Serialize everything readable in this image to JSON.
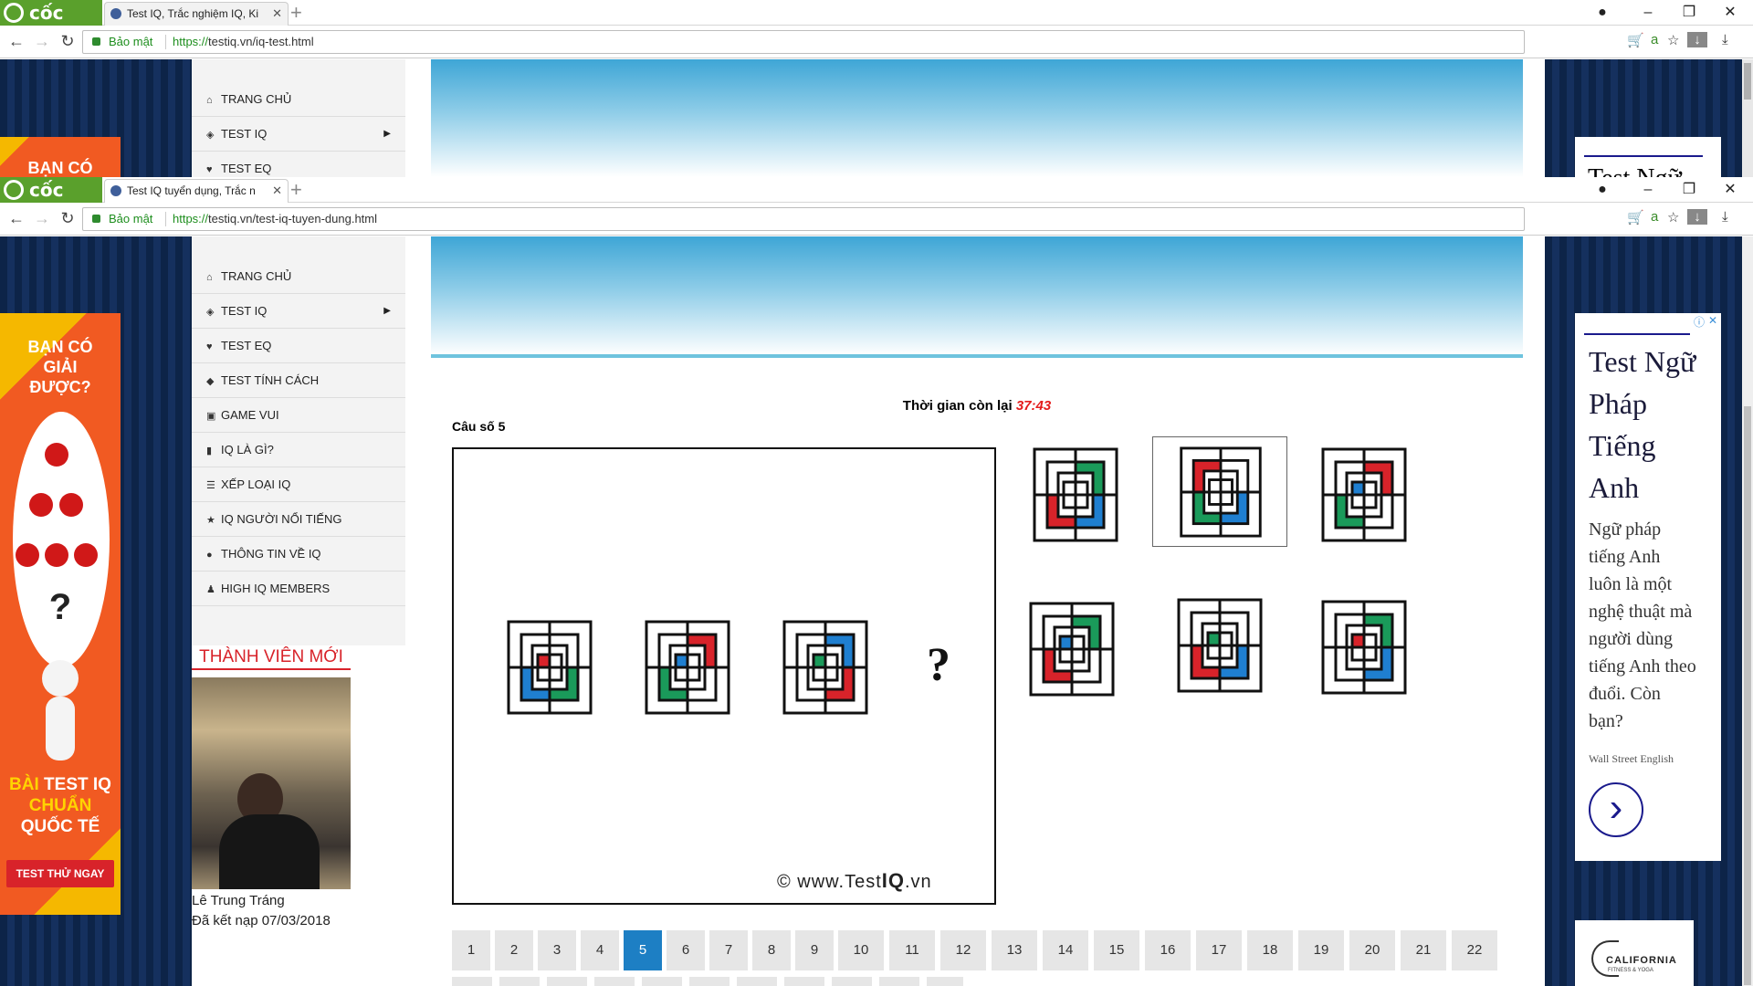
{
  "browser_back": {
    "app_name": "cốc cốc",
    "tab_title": "Test IQ, Trắc nghiệm IQ, Ki",
    "secure_label": "Bảo mật",
    "url_scheme": "https://",
    "url_rest": "testiq.vn/iq-test.html",
    "menu": [
      "TRANG CHỦ",
      "TEST IQ",
      "TEST EQ"
    ],
    "ad_partial": "Test Ngữ",
    "orange_partial": "BẠN CÓ"
  },
  "browser": {
    "app_name": "cốc cốc",
    "tab_title": "Test IQ tuyển dụng, Trắc n",
    "secure_label": "Bảo mật",
    "url_scheme": "https://",
    "url_rest": "testiq.vn/test-iq-tuyen-dung.html"
  },
  "sidebar": {
    "items": [
      {
        "label": "TRANG CHỦ",
        "icon": "home-icon"
      },
      {
        "label": "TEST IQ",
        "icon": "shield-icon",
        "has_submenu": true
      },
      {
        "label": "TEST EQ",
        "icon": "heart-icon"
      },
      {
        "label": "TEST TÍNH CÁCH",
        "icon": "chat-icon"
      },
      {
        "label": "GAME VUI",
        "icon": "gamepad-icon"
      },
      {
        "label": "IQ LÀ GÌ?",
        "icon": "book-icon"
      },
      {
        "label": "XẾP LOẠI IQ",
        "icon": "list-icon"
      },
      {
        "label": "IQ NGƯỜI NỔI TIẾNG",
        "icon": "star-icon"
      },
      {
        "label": "THÔNG TIN VỀ IQ",
        "icon": "info-icon"
      },
      {
        "label": "HIGH IQ MEMBERS",
        "icon": "users-icon"
      }
    ],
    "new_member_heading": "THÀNH VIÊN MỚI",
    "member_name": "Lê Trung Tráng",
    "member_joined": "Đã kết nạp 07/03/2018"
  },
  "left_ad": {
    "headline": [
      "BẠN CÓ",
      "GIẢI",
      "ĐƯỢC?"
    ],
    "tagline_lines": [
      "BÀI TEST IQ",
      "CHUẨN",
      "QUỐC TẾ"
    ],
    "tagline_highlight_words": [
      "BÀI",
      "CHUẨN"
    ],
    "cta": "TEST THỬ NGAY",
    "puzzle_mark": "?"
  },
  "quiz": {
    "timer_label": "Thời gian còn lại",
    "timer_value": "37:43",
    "question_label": "Câu số 5",
    "question_mark": "?",
    "watermark_prefix": "© www.Test",
    "watermark_bold": "IQ",
    "watermark_suffix": ".vn",
    "colors": {
      "red": "#d8232a",
      "green": "#1a9a5a",
      "blue": "#1f7fd0"
    },
    "sequence": [
      {
        "tr": "none",
        "br": "green",
        "bl": "blue",
        "tl": "none",
        "inner": "red"
      },
      {
        "tr": "red",
        "br": "none",
        "bl": "green",
        "tl": "none",
        "inner": "blue"
      },
      {
        "tr": "blue",
        "br": "red",
        "bl": "none",
        "tl": "none",
        "inner": "green"
      }
    ],
    "options": [
      {
        "tr": "green",
        "br": "blue",
        "bl": "red",
        "tl": "none",
        "inner": "none",
        "selected": false
      },
      {
        "tr": "none",
        "br": "blue",
        "bl": "green",
        "tl": "red",
        "inner": "none",
        "selected": true
      },
      {
        "tr": "red",
        "br": "none",
        "bl": "green",
        "tl": "none",
        "inner": "blue",
        "selected": false
      },
      {
        "tr": "green",
        "br": "none",
        "bl": "red",
        "tl": "none",
        "inner": "blue",
        "selected": false
      },
      {
        "tr": "none",
        "br": "blue",
        "bl": "red",
        "tl": "none",
        "inner": "green",
        "selected": false
      },
      {
        "tr": "green",
        "br": "blue",
        "bl": "none",
        "tl": "none",
        "inner": "red",
        "selected": false
      }
    ]
  },
  "pagination": {
    "pages": [
      "1",
      "2",
      "3",
      "4",
      "5",
      "6",
      "7",
      "8",
      "9",
      "10",
      "11",
      "12",
      "13",
      "14",
      "15",
      "16",
      "17",
      "18",
      "19",
      "20",
      "21",
      "22"
    ],
    "current": "5"
  },
  "right_ad": {
    "title_lines": [
      "Test Ngữ",
      "Pháp",
      "Tiếng",
      "Anh"
    ],
    "body_lines": [
      "Ngữ pháp",
      "tiếng Anh",
      "luôn là một",
      "nghệ thuật mà",
      "người dùng",
      "tiếng Anh theo",
      "đuổi. Còn",
      "bạn?"
    ],
    "sponsor": "Wall Street English",
    "adchoice": "ⓘ",
    "close": "✕",
    "next_arrow": "›",
    "second_ad_brand": "CALIFORNIA",
    "second_ad_sub": "FITNESS & YOGA"
  }
}
